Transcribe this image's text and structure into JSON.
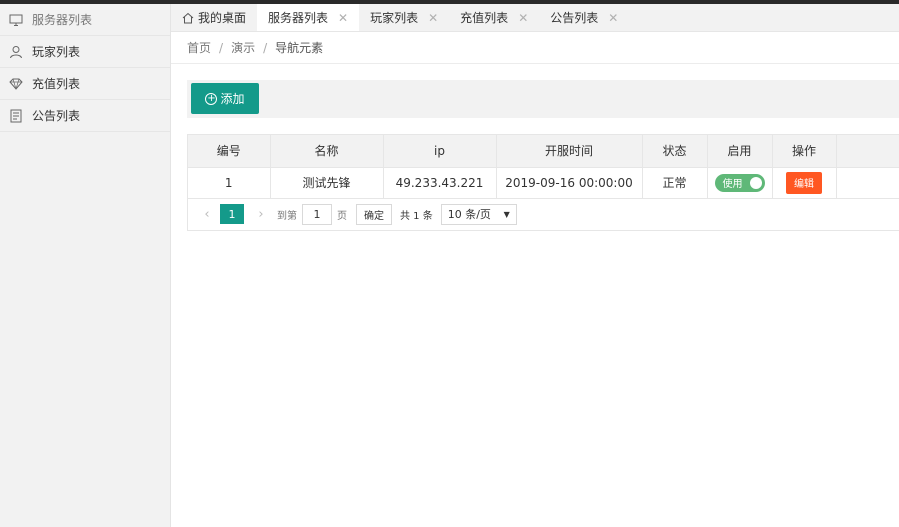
{
  "sidebar": {
    "items": [
      {
        "label": "服务器列表",
        "icon": "monitor-icon"
      },
      {
        "label": "玩家列表",
        "icon": "user-icon"
      },
      {
        "label": "充值列表",
        "icon": "diamond-icon"
      },
      {
        "label": "公告列表",
        "icon": "document-icon"
      }
    ]
  },
  "tabs": [
    {
      "label": "我的桌面"
    },
    {
      "label": "服务器列表"
    },
    {
      "label": "玩家列表"
    },
    {
      "label": "充值列表"
    },
    {
      "label": "公告列表"
    }
  ],
  "breadcrumb": {
    "items": [
      "首页",
      "演示",
      "导航元素"
    ],
    "separator": "/"
  },
  "toolbar": {
    "add_label": "添加"
  },
  "table": {
    "headers": [
      "编号",
      "名称",
      "ip",
      "开服时间",
      "状态",
      "启用",
      "操作"
    ],
    "rows": [
      {
        "id": "1",
        "name": "测试先锋",
        "ip": "49.233.43.221",
        "open_time": "2019-09-16 00:00:00",
        "status": "正常",
        "enable": "使用",
        "action": "编辑"
      }
    ]
  },
  "pager": {
    "current": "1",
    "goto_prefix": "到第",
    "goto_value": "1",
    "goto_suffix": "页",
    "confirm": "确定",
    "total": "共 1 条",
    "page_size": "10 条/页"
  },
  "colors": {
    "accent": "#149a8a",
    "edit": "#ff5722",
    "toggle_on": "#5fb878"
  }
}
